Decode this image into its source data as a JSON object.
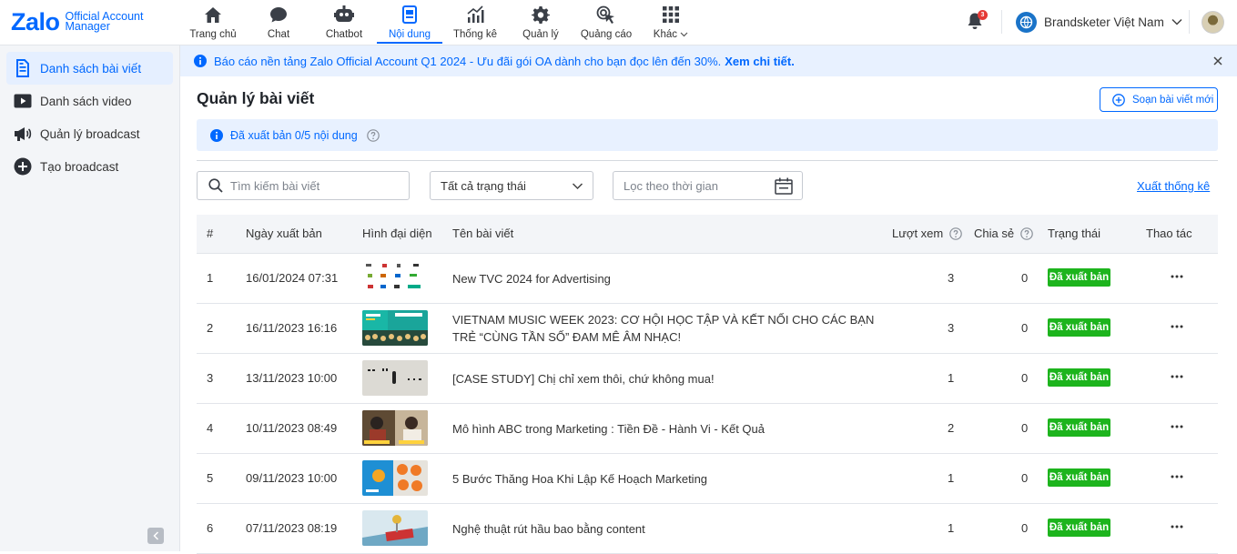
{
  "logo": {
    "brand": "Zalo",
    "line1": "Official Account",
    "line2": "Manager"
  },
  "nav": [
    {
      "label": "Trang chủ",
      "icon": "home-icon"
    },
    {
      "label": "Chat",
      "icon": "chat-icon"
    },
    {
      "label": "Chatbot",
      "icon": "chatbot-icon"
    },
    {
      "label": "Nội dung",
      "icon": "content-icon",
      "active": true
    },
    {
      "label": "Thống kê",
      "icon": "stats-icon"
    },
    {
      "label": "Quản lý",
      "icon": "gear-icon"
    },
    {
      "label": "Quảng cáo",
      "icon": "ads-icon"
    },
    {
      "label": "Khác",
      "icon": "grid-icon"
    }
  ],
  "notifications": {
    "count": "3"
  },
  "account": {
    "name": "Brandsketer Việt Nam"
  },
  "sidebar": {
    "items": [
      {
        "label": "Danh sách bài viết",
        "icon": "article-list-icon",
        "active": true
      },
      {
        "label": "Danh sách video",
        "icon": "video-icon"
      },
      {
        "label": "Quản lý broadcast",
        "icon": "megaphone-icon"
      },
      {
        "label": "Tạo broadcast",
        "icon": "plus-circle-icon"
      }
    ]
  },
  "banner": {
    "text": "Báo cáo nền tảng Zalo Official Account Q1 2024 - Ưu đãi gói OA dành cho bạn đọc lên đến 30%.",
    "link": "Xem chi tiết."
  },
  "main": {
    "title": "Quản lý bài viết",
    "new_button": "Soạn bài viết mới",
    "info": "Đã xuất bản 0/5 nội dung",
    "search_placeholder": "Tìm kiếm bài viết",
    "status_filter": "Tất cả trạng thái",
    "date_placeholder": "Lọc theo thời gian",
    "export_link": "Xuất thống kê"
  },
  "table": {
    "headers": {
      "index": "#",
      "date": "Ngày xuất bản",
      "thumb": "Hình đại diện",
      "title": "Tên bài viết",
      "views": "Lượt xem",
      "shares": "Chia sẻ",
      "status": "Trạng thái",
      "actions": "Thao tác"
    },
    "rows": [
      {
        "index": "1",
        "date": "16/01/2024 07:31",
        "title": "New TVC 2024 for Advertising",
        "views": "3",
        "shares": "0",
        "status": "Đã xuất bản"
      },
      {
        "index": "2",
        "date": "16/11/2023 16:16",
        "title": "VIETNAM MUSIC WEEK 2023: CƠ HỘI HỌC TẬP VÀ KẾT NỐI CHO CÁC BẠN TRẺ “CÙNG TẦN SỐ” ĐAM MÊ ÂM NHẠC!",
        "views": "3",
        "shares": "0",
        "status": "Đã xuất bản"
      },
      {
        "index": "3",
        "date": "13/11/2023 10:00",
        "title": "[CASE STUDY] Chị chỉ xem thôi, chứ không mua!",
        "views": "1",
        "shares": "0",
        "status": "Đã xuất bản"
      },
      {
        "index": "4",
        "date": "10/11/2023 08:49",
        "title": "Mô hình ABC trong Marketing : Tiền Đề - Hành Vi - Kết Quả",
        "views": "2",
        "shares": "0",
        "status": "Đã xuất bản"
      },
      {
        "index": "5",
        "date": "09/11/2023 10:00",
        "title": "5 Bước Thăng Hoa Khi Lập Kế Hoạch Marketing",
        "views": "1",
        "shares": "0",
        "status": "Đã xuất bản"
      },
      {
        "index": "6",
        "date": "07/11/2023 08:19",
        "title": "Nghệ thuật rút hầu bao bằng content",
        "views": "1",
        "shares": "0",
        "status": "Đã xuất bản"
      }
    ]
  },
  "colors": {
    "accent": "#0068ff",
    "success": "#1db41d",
    "banner_bg": "#e8f1ff"
  }
}
